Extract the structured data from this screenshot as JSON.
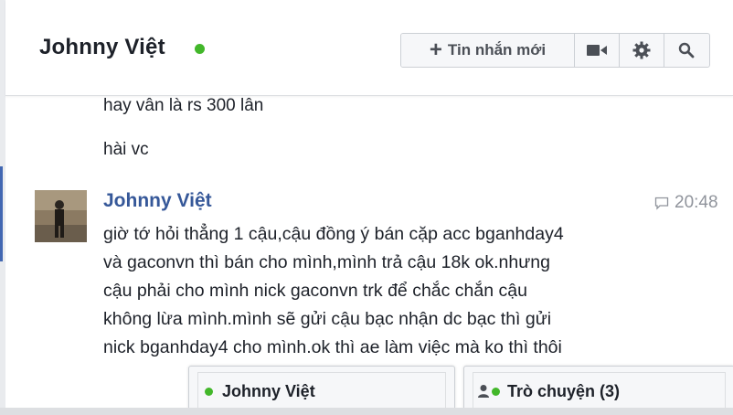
{
  "header": {
    "title": "Johnny Việt",
    "new_message_label": "Tin nhắn mới"
  },
  "messages": {
    "previous_lines": [
      "hay vân là rs 300 lân",
      "hài vc"
    ],
    "sender": "Johnny Việt",
    "time": "20:48",
    "body_lines": [
      "giờ tớ hỏi thẳng 1 cậu,cậu đồng ý bán cặp acc bganhday4",
      "và gaconvn thì bán cho mình,mình trả cậu 18k ok.nhưng",
      "cậu phải cho mình nick gaconvn trk để chắc chắn cậu",
      "không lừa mình.mình sẽ gửi cậu bạc nhận dc bạc thì gửi",
      "nick bganhday4 cho mình.ok thì ae làm việc mà ko thì thôi"
    ]
  },
  "chat_tabs": [
    {
      "label": "Johnny Việt"
    },
    {
      "label": "Trò chuyện (3)"
    }
  ],
  "colors": {
    "online": "#42b72a",
    "name_link": "#365899",
    "toolbar_bg": "#f6f7f9"
  },
  "icons": [
    "plus-icon",
    "video-camera-icon",
    "gear-icon",
    "search-icon",
    "comment-icon",
    "person-icon"
  ]
}
